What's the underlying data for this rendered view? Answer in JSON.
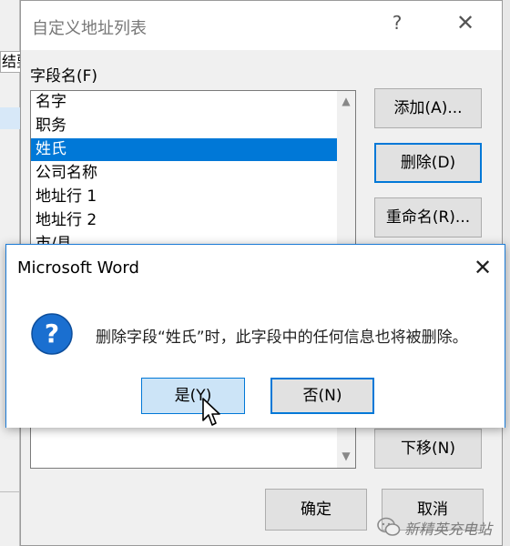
{
  "background_window": {
    "field_fragment": "结要"
  },
  "address_dialog": {
    "title": "自定义地址列表",
    "help_glyph": "?",
    "close_glyph": "✕",
    "field_label": "字段名(F)",
    "fields": [
      "名字",
      "职务",
      "姓氏",
      "公司名称",
      "地址行 1",
      "地址行 2",
      "市/县"
    ],
    "selected_field": "姓氏",
    "buttons": {
      "add": "添加(A)...",
      "delete": "删除(D)",
      "rename": "重命名(R)...",
      "move_down": "下移(N)",
      "ok": "确定",
      "cancel": "取消"
    }
  },
  "message_box": {
    "title": "Microsoft Word",
    "close_glyph": "✕",
    "icon": "question-icon",
    "message": "删除字段“姓氏”时，此字段中的任何信息也将被删除。",
    "yes_label": "是(Y)",
    "no_label": "否(N)"
  },
  "watermark": {
    "text": "新精英充电站",
    "icon": "wechat-icon"
  },
  "colors": {
    "accent": "#0078d7",
    "selection": "#0078d7",
    "question_icon": "#1a6fd0"
  }
}
